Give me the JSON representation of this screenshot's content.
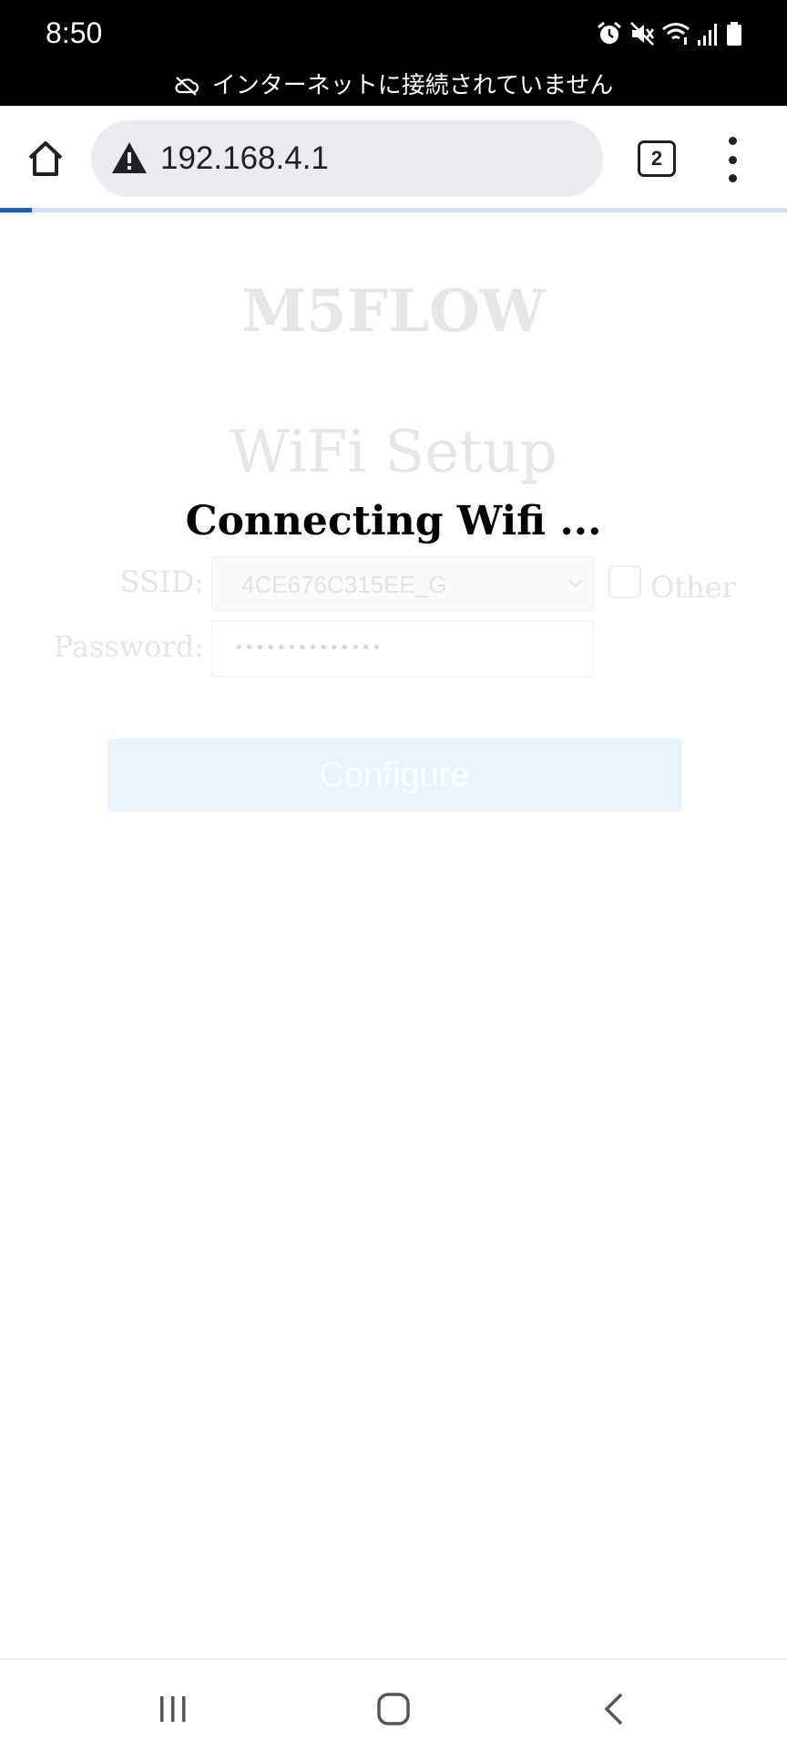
{
  "status_bar": {
    "time": "8:50",
    "offline_message": "インターネットに接続されていません",
    "icons": [
      "alarm-icon",
      "mute-icon",
      "wifi-icon",
      "signal-icon",
      "battery-icon"
    ]
  },
  "browser": {
    "url": "192.168.4.1",
    "tab_count": "2",
    "load_progress": 0.04,
    "icons": [
      "home-icon",
      "warning-icon",
      "tabs-icon",
      "more-vert-icon"
    ]
  },
  "page": {
    "brand_title": "M5FLOW",
    "setup_title": "WiFi Setup",
    "connecting_message": "Connecting Wifi ...",
    "ssid_label": "SSID:",
    "ssid_value": "4CE676C315EE_G",
    "other_label": "Other",
    "password_label": "Password:",
    "password_masked": "••••••••••••••",
    "configure_label": "Configure"
  },
  "nav_bar": {
    "icons": [
      "recents-icon",
      "home-icon",
      "back-icon"
    ]
  },
  "colors": {
    "status_bar_bg": "#000000",
    "url_pill_bg": "#e9ebee",
    "progress_fill": "#1a5cc8",
    "progress_track": "#d4dff0",
    "faded_text": "#e6e6e6",
    "configure_bg": "#e8f3fc"
  }
}
